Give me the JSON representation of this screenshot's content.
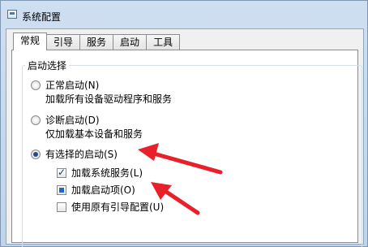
{
  "window": {
    "title": "系统配置"
  },
  "tabs": [
    "常规",
    "引导",
    "服务",
    "启动",
    "工具"
  ],
  "group": {
    "label": "启动选择"
  },
  "options": {
    "normal": {
      "label": "正常启动(N)",
      "desc": "加载所有设备驱动程序和服务"
    },
    "diagnostic": {
      "label": "诊断启动(D)",
      "desc": "仅加载基本设备和服务"
    },
    "selective": {
      "label": "有选择的启动(S)"
    }
  },
  "checks": {
    "load_services": "加载系统服务(L)",
    "load_startup": "加载启动项(O)",
    "original_boot": "使用原有引导配置(U)"
  },
  "colors": {
    "annotation_arrow": "#e8202a",
    "accent": "#1d4e91"
  }
}
